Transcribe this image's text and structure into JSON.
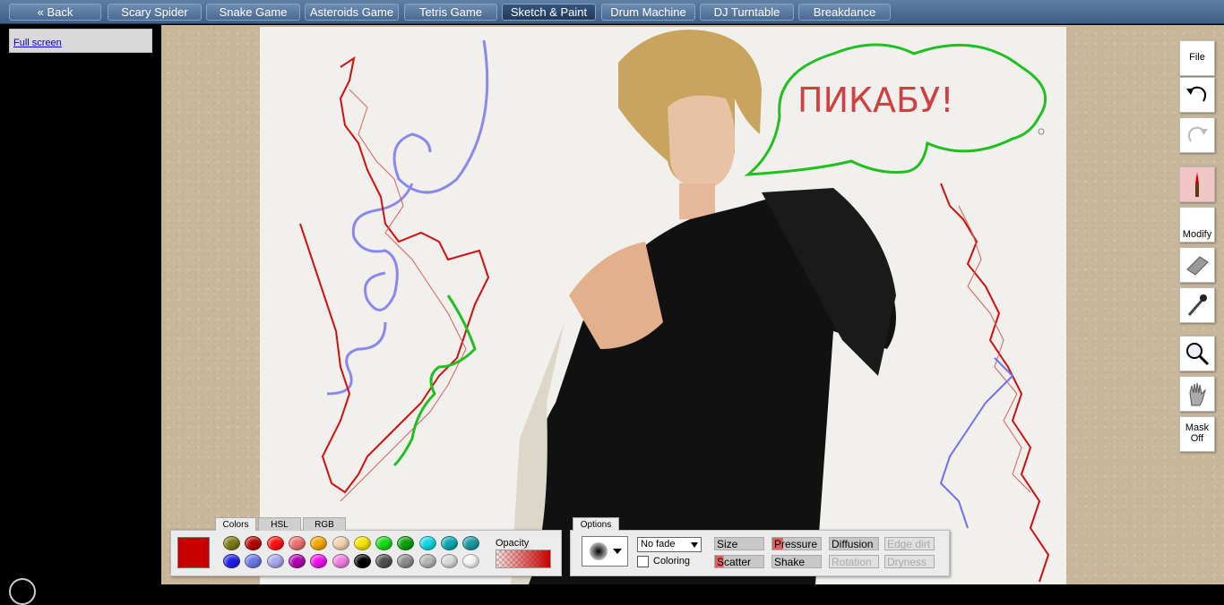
{
  "nav": {
    "items": [
      {
        "label": "« Back",
        "active": false
      },
      {
        "label": "Scary Spider",
        "active": false
      },
      {
        "label": "Snake Game",
        "active": false
      },
      {
        "label": "Asteroids Game",
        "active": false
      },
      {
        "label": "Tetris Game",
        "active": false
      },
      {
        "label": "Sketch & Paint",
        "active": true
      },
      {
        "label": "Drum Machine",
        "active": false
      },
      {
        "label": "DJ Turntable",
        "active": false
      },
      {
        "label": "Breakdance",
        "active": false
      }
    ]
  },
  "sidebar": {
    "fullscreen_link": "Full screen"
  },
  "canvas": {
    "speech_text": "ПИКАБУ!"
  },
  "tools": {
    "file": "File",
    "undo_icon": "undo-arrow-icon",
    "redo_icon": "redo-arrow-icon",
    "brush_icon": "paintbrush-icon",
    "modify": "Modify",
    "eraser_icon": "eraser-icon",
    "eyedropper_icon": "eyedropper-icon",
    "zoom_icon": "magnifier-icon",
    "hand_icon": "hand-icon",
    "mask_line1": "Mask",
    "mask_line2": "Off"
  },
  "colors_panel": {
    "tabs": [
      "Colors",
      "HSL",
      "RGB"
    ],
    "active_tab": "Colors",
    "current_color": "#c80000",
    "swatches_row1": [
      "#7b7a14",
      "#b50000",
      "#ff1010",
      "#f07070",
      "#f4a800",
      "#f2d2b0",
      "#f5e400",
      "#18d818",
      "#0aa00a",
      "#10d8e0",
      "#08a8b0",
      "#1a9aa0"
    ],
    "swatches_row2": [
      "#2020e8",
      "#6878e8",
      "#a8a8e8",
      "#b000b0",
      "#f010f0",
      "#f080e0",
      "#000000",
      "#505050",
      "#8c8c8c",
      "#b4b4b4",
      "#d8d8d8",
      "#f4f4f4"
    ],
    "opacity_label": "Opacity"
  },
  "options_panel": {
    "tab": "Options",
    "fade_value": "No fade",
    "coloring_label": "Coloring",
    "buttons": [
      {
        "label": "Size",
        "state": "normal"
      },
      {
        "label": "Pressure",
        "state": "red"
      },
      {
        "label": "Diffusion",
        "state": "normal"
      },
      {
        "label": "Edge dirt",
        "state": "dim"
      },
      {
        "label": "Scatter",
        "state": "red2"
      },
      {
        "label": "Shake",
        "state": "normal"
      },
      {
        "label": "Rotation",
        "state": "dim"
      },
      {
        "label": "Dryness",
        "state": "dim"
      }
    ]
  }
}
